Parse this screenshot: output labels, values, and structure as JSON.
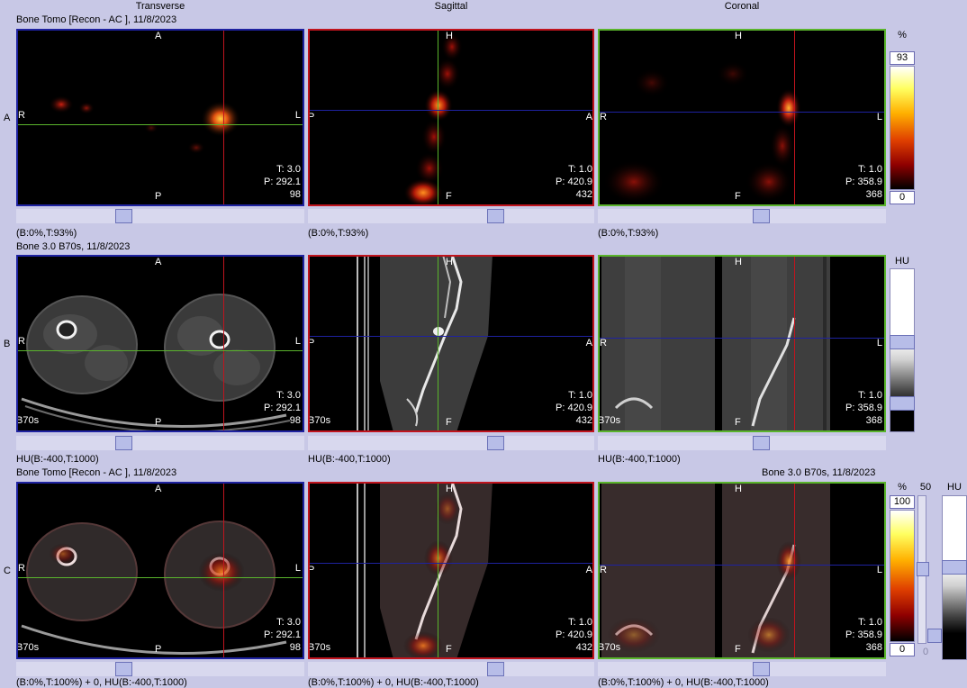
{
  "views": {
    "transverse": "Transverse",
    "sagittal": "Sagittal",
    "coronal": "Coronal"
  },
  "rows": {
    "A": {
      "label": "A",
      "title": "Bone Tomo [Recon - AC ], 11/8/2023",
      "window": "(B:0%,T:93%)"
    },
    "B": {
      "label": "B",
      "title": "Bone  3.0  B70s, 11/8/2023",
      "window": "HU(B:-400,T:1000)"
    },
    "C": {
      "label": "C",
      "title": "Bone Tomo [Recon - AC ], 11/8/2023",
      "title_right": "Bone  3.0  B70s, 11/8/2023",
      "window": "(B:0%,T:100%) + 0, HU(B:-400,T:1000)"
    }
  },
  "orient": {
    "transverse": {
      "top": "A",
      "bottom": "P",
      "left": "R",
      "right": "L"
    },
    "sagittal": {
      "top": "H",
      "bottom": "F",
      "left": "P",
      "right": "A"
    },
    "coronal": {
      "top": "H",
      "bottom": "F",
      "left": "R",
      "right": "L"
    }
  },
  "info": {
    "transverse": {
      "t": "T: 3.0",
      "p": "P: 292.1",
      "n": "98"
    },
    "sagittal": {
      "t": "T: 1.0",
      "p": "P: 420.9",
      "n": "432"
    },
    "coronal": {
      "t": "T: 1.0",
      "p": "P: 358.9",
      "n": "368"
    },
    "pet_transverse": {
      "t": "T: 3.0"
    }
  },
  "kernel": "B70s",
  "colorbars": {
    "A": {
      "unit": "%",
      "top": "93",
      "bottom": "0"
    },
    "B": {
      "unit": "HU"
    },
    "C": {
      "unit": "%",
      "top": "100",
      "bottom": "0",
      "mid": "50",
      "ct_unit": "HU",
      "ct_bottom": "0"
    }
  },
  "colors": {
    "blue": "#1e22a0",
    "red": "#c0141e",
    "green": "#5ab42c",
    "background": "#c8c8e6"
  }
}
